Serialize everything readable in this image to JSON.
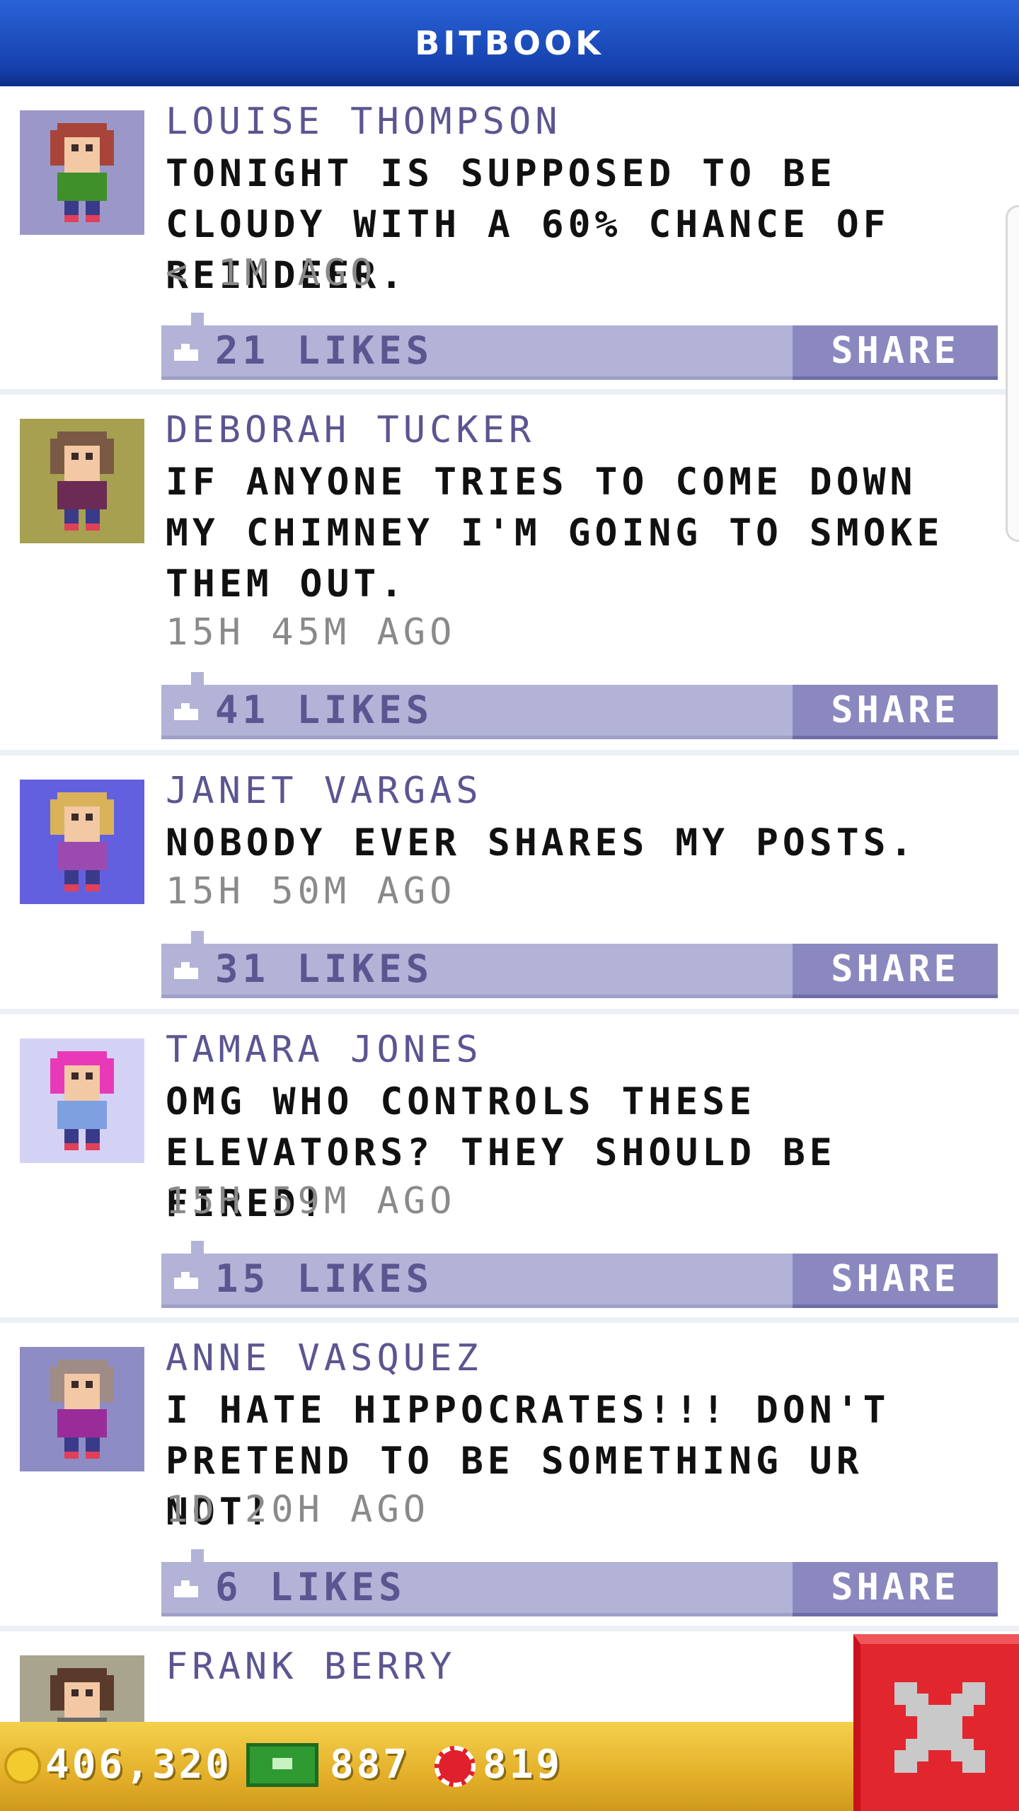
{
  "header": {
    "title": "BITBOOK"
  },
  "posts": [
    {
      "name": "LOUISE THOMPSON",
      "message": "TONIGHT IS SUPPOSED TO BE CLOUDY WITH A 60% CHANCE OF REINDEER.",
      "time": "< 1M AGO",
      "likes": "21 LIKES",
      "share_label": "SHARE",
      "avatar_bg": "#9b98c9",
      "hair": "#a8453a",
      "shirt": "#3f8f2a"
    },
    {
      "name": "DEBORAH TUCKER",
      "message": "IF ANYONE TRIES TO COME DOWN MY CHIMNEY I'M GOING TO SMOKE THEM OUT.",
      "time": "15H 45M AGO",
      "likes": "41 LIKES",
      "share_label": "SHARE",
      "avatar_bg": "#a6a050",
      "hair": "#7a5a44",
      "shirt": "#6b2b55"
    },
    {
      "name": "JANET VARGAS",
      "message": "NOBODY EVER SHARES MY POSTS.",
      "time": "15H 50M AGO",
      "likes": "31 LIKES",
      "share_label": "SHARE",
      "avatar_bg": "#6360e0",
      "hair": "#d9b25a",
      "shirt": "#9b4bb0"
    },
    {
      "name": "TAMARA JONES",
      "message": "OMG WHO CONTROLS THESE ELEVATORS? THEY SHOULD BE FIRED!",
      "time": "15H 59M AGO",
      "likes": "15 LIKES",
      "share_label": "SHARE",
      "avatar_bg": "#d4d2f4",
      "hair": "#e83ab8",
      "shirt": "#7fa0e0"
    },
    {
      "name": "ANNE VASQUEZ",
      "message": "I HATE HIPPOCRATES!!! DON'T PRETEND TO BE SOMETHING UR NOT!",
      "time": "1D 20H AGO",
      "likes": "6 LIKES",
      "share_label": "SHARE",
      "avatar_bg": "#8e8cc4",
      "hair": "#a08c86",
      "shirt": "#9a2c9a"
    },
    {
      "name": "FRANK BERRY",
      "message": "",
      "time": "",
      "likes": "",
      "share_label": "",
      "avatar_bg": "#a8a48e",
      "hair": "#5a3a2a",
      "shirt": "#6a6a6a"
    }
  ],
  "currency": {
    "coins": "406,320",
    "bux": "887",
    "chips": "819"
  }
}
